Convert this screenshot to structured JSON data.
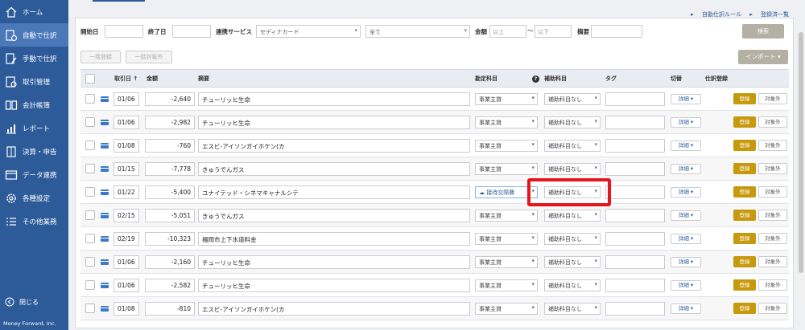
{
  "sidebar": {
    "items": [
      {
        "label": "ホーム",
        "icon": "home-icon"
      },
      {
        "label": "自動で仕訳",
        "icon": "auto-journal-icon",
        "active": true
      },
      {
        "label": "手動で仕訳",
        "icon": "manual-journal-icon"
      },
      {
        "label": "取引管理",
        "icon": "transaction-icon"
      },
      {
        "label": "会計帳簿",
        "icon": "ledger-book-icon"
      },
      {
        "label": "レポート",
        "icon": "report-chart-icon"
      },
      {
        "label": "決算・申告",
        "icon": "settlement-icon"
      },
      {
        "label": "データ連携",
        "icon": "data-link-icon"
      },
      {
        "label": "各種設定",
        "icon": "gear-icon"
      },
      {
        "label": "その他業務",
        "icon": "list-icon"
      }
    ],
    "close_label": "閉じる",
    "brand": "Money Forward, Inc."
  },
  "top_links": {
    "rules": "自動仕訳ルール",
    "registered": "登録済一覧"
  },
  "filters": {
    "start_label": "開始日",
    "end_label": "終了日",
    "service_label": "連携サービス",
    "service_value": "セディナカード",
    "all_value": "全て",
    "amount_label": "金額",
    "amount_min_placeholder": "以上",
    "tilde": "〜",
    "amount_max_placeholder": "以下",
    "summary_label": "摘要",
    "search_button": "検索"
  },
  "actions": {
    "bulk_register": "一括登録",
    "bulk_exclude": "一括対象外",
    "import": "インポート ▾"
  },
  "table": {
    "headers": {
      "date": "取引日 ↑",
      "amount": "金額",
      "summary": "摘要",
      "account": "勘定科目",
      "help": "?",
      "sub_account": "補助科目",
      "tag": "タグ",
      "tax": "切替",
      "register": "仕訳登録"
    },
    "detail_label": "詳細 ▾",
    "register_label": "登録",
    "exclude_label": "対象外",
    "rows": [
      {
        "date": "01/06",
        "amount": "-2,640",
        "summary": "チューリッヒ生命",
        "account": "事業主貸",
        "sub": "補助科目なし"
      },
      {
        "date": "01/06",
        "amount": "-2,982",
        "summary": "チューリッヒ生命",
        "account": "事業主貸",
        "sub": "補助科目なし"
      },
      {
        "date": "01/08",
        "amount": "-760",
        "summary": "エスビ-アイソンガイホケン(カ",
        "account": "事業主貸",
        "sub": "補助科目なし"
      },
      {
        "date": "01/15",
        "amount": "-7,778",
        "summary": "きゅうでんガス",
        "account": "事業主貸",
        "sub": "補助科目なし"
      },
      {
        "date": "01/22",
        "amount": "-5,400",
        "summary": "ユナイテッド・シネマキャナルシテ",
        "account": "接待交際費",
        "sub": "補助科目なし",
        "highlight": true
      },
      {
        "date": "02/15",
        "amount": "-5,051",
        "summary": "きゅうでんガス",
        "account": "事業主貸",
        "sub": "補助科目なし"
      },
      {
        "date": "02/19",
        "amount": "-10,323",
        "summary": "福岡市上下水道料金",
        "account": "事業主貸",
        "sub": "補助科目なし"
      },
      {
        "date": "01/06",
        "amount": "-2,160",
        "summary": "チューリッヒ生命",
        "account": "事業主貸",
        "sub": "補助科目なし"
      },
      {
        "date": "01/06",
        "amount": "-2,582",
        "summary": "チューリッヒ生命",
        "account": "事業主貸",
        "sub": "補助科目なし"
      },
      {
        "date": "01/08",
        "amount": "-810",
        "summary": "エスビ-アイソンガイホケン(カ",
        "account": "事業主貸",
        "sub": "補助科目なし"
      }
    ]
  },
  "colors": {
    "sidebar": "#2d5b9a",
    "sidebar_active": "#4a78b8",
    "register": "#c79a0e",
    "highlight_border": "#e8141c"
  }
}
